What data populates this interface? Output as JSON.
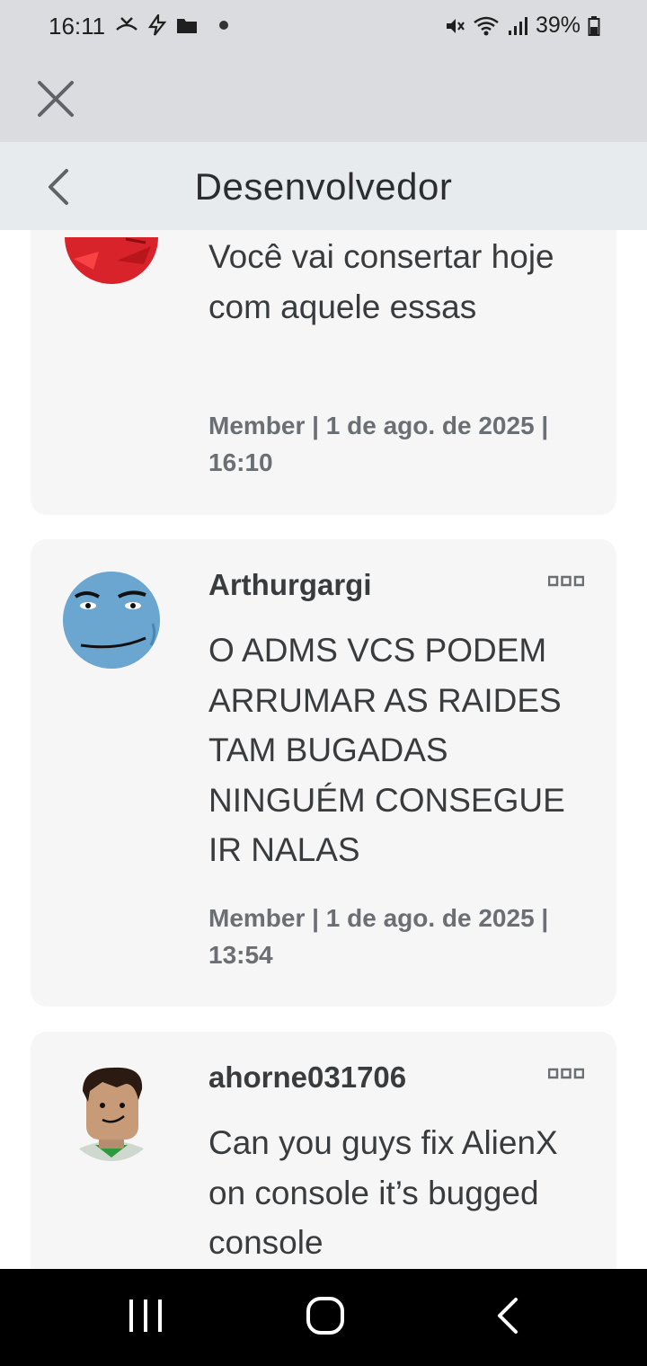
{
  "status_bar": {
    "time": "16:11",
    "battery": "39%",
    "left_icons": [
      "missed-call-icon",
      "flash-icon",
      "folder-icon",
      "dot-icon"
    ],
    "right_icons": [
      "mute-icon",
      "wifi-icon",
      "signal-icon",
      "battery-icon"
    ]
  },
  "header": {
    "title": "Desenvolvedor"
  },
  "posts": [
    {
      "username": "",
      "text": "Você vai consertar hoje com aquele essas",
      "meta": "Member | 1 de ago. de 2025 | 16:10"
    },
    {
      "username": "Arthurgargi",
      "text": "O ADMS VCS PODEM ARRUMAR AS RAIDES TAM BUGADAS NINGUÉM CONSEGUE IR NALAS",
      "meta": "Member | 1 de ago. de 2025 | 13:54"
    },
    {
      "username": "ahorne031706",
      "text": "Can you guys fix AlienX on console it’s bugged console",
      "meta": ""
    }
  ],
  "colors": {
    "status_bg": "#dadcdf",
    "header_bg": "#e8ebee",
    "card_bg": "#f6f6f7",
    "text": "#393b3d",
    "meta": "#6b6e73"
  }
}
